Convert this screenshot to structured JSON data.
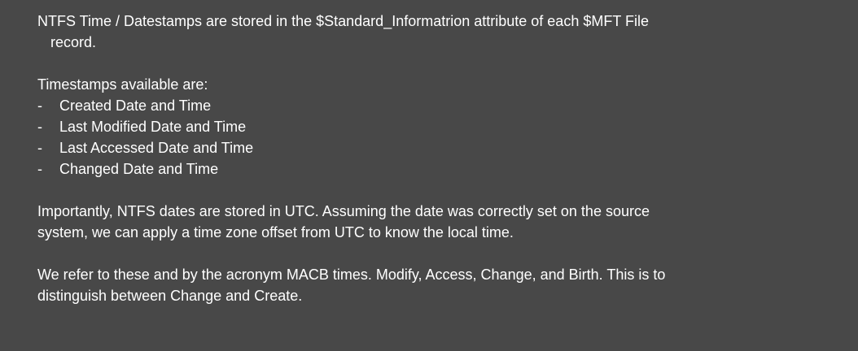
{
  "intro": {
    "line1": "NTFS Time / Datestamps are stored in the $Standard_Informatrion attribute of each $MFT File",
    "line2": "record."
  },
  "timestamps": {
    "heading": "Timestamps available are:",
    "dash": "-",
    "items": [
      "Created Date and Time",
      "Last Modified Date and Time",
      "Last Accessed Date and Time",
      "Changed Date and Time"
    ]
  },
  "utc_note": {
    "line1": "Importantly, NTFS dates are stored in UTC.  Assuming the date was correctly set on the source",
    "line2": "system, we can apply a time zone offset from UTC to know the local time."
  },
  "macb_note": {
    "line1": "We refer to these and by the acronym MACB times.  Modify, Access, Change, and Birth.  This is to",
    "line2": "distinguish between Change and Create."
  }
}
